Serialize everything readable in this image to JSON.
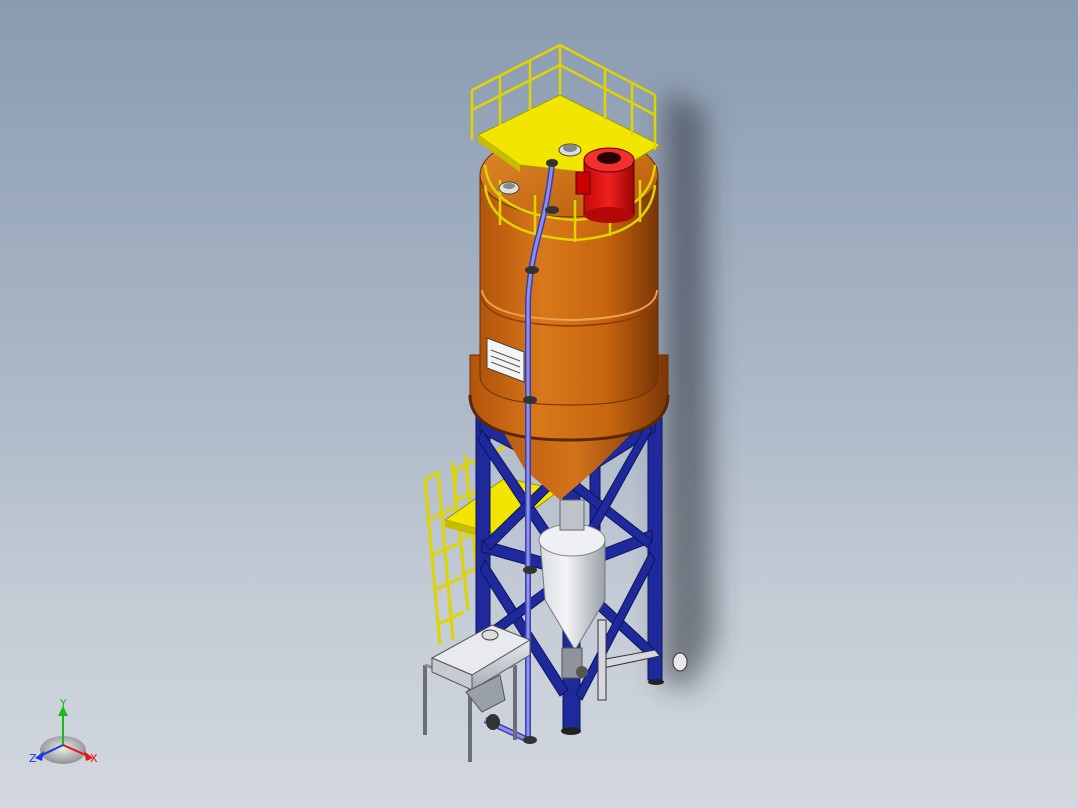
{
  "view": {
    "background_top": "#8a9bb0",
    "background_bottom": "#d3d8de"
  },
  "model": {
    "silo_color": "#c8660f",
    "frame_color": "#1e2a9c",
    "platform_color": "#f2e600",
    "filter_color": "#e01010",
    "pipe_color": "#6b6fe8"
  },
  "triad": {
    "x_label": "X",
    "y_label": "Y",
    "z_label": "Z",
    "x_color": "#e01818",
    "y_color": "#18b818",
    "z_color": "#1838e0"
  }
}
